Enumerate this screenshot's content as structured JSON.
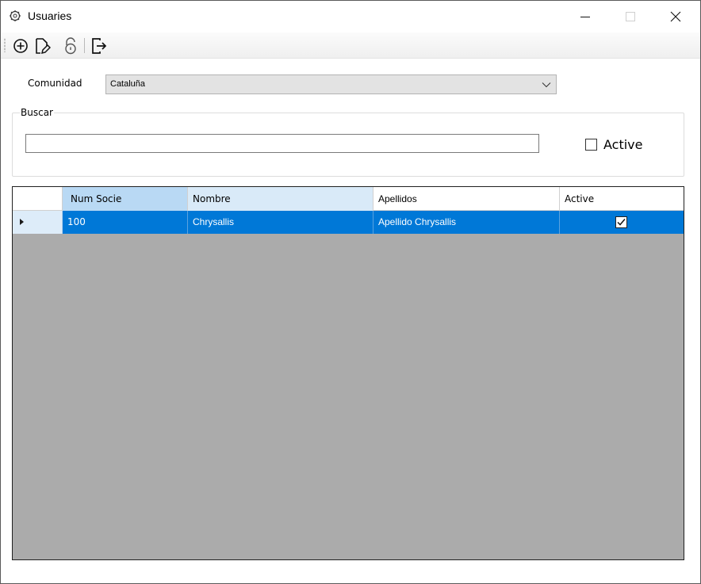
{
  "window": {
    "title": "Usuaries",
    "controls": {
      "minimize": "minimize-icon",
      "maximize": "maximize-icon",
      "close": "close-icon"
    }
  },
  "toolbar": {
    "buttons": [
      {
        "icon": "add-circle-icon"
      },
      {
        "icon": "edit-document-icon"
      },
      {
        "icon": "unlock-icon"
      },
      {
        "icon": "exit-icon"
      }
    ]
  },
  "filters": {
    "comunidad_label": "Comunidad",
    "comunidad_value": "Cataluña",
    "buscar_label": "Buscar",
    "search_value": "",
    "active_label": "Active",
    "active_checked": false
  },
  "grid": {
    "columns": [
      "Num Socie",
      "Nombre",
      "Apellidos",
      "Active"
    ],
    "rows": [
      {
        "num_socie": "100",
        "nombre": "Chrysallis",
        "apellidos": "Apellido Chrysallis",
        "active": true,
        "selected": true
      }
    ]
  },
  "colors": {
    "selection": "#0078d7",
    "grid_background": "#ababab",
    "select_background": "#e3e3e3"
  }
}
